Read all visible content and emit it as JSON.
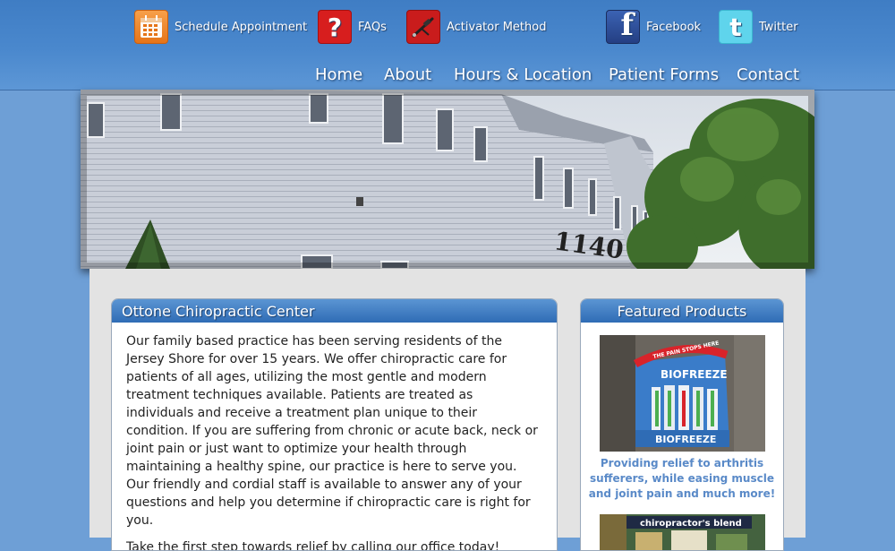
{
  "header": {
    "top_links": [
      {
        "label": "Schedule Appointment",
        "icon": "calendar-icon"
      },
      {
        "label": "FAQs",
        "icon": "question-mark-icon"
      },
      {
        "label": "Activator Method",
        "icon": "activator-tool-icon"
      },
      {
        "label": "Facebook",
        "icon": "facebook-icon"
      },
      {
        "label": "Twitter",
        "icon": "twitter-icon"
      }
    ],
    "nav": [
      "Home",
      "About",
      "Hours & Location",
      "Patient Forms",
      "Contact"
    ]
  },
  "banner": {
    "building_number": "1140"
  },
  "main_panel": {
    "title": "Ottone Chiropractic Center",
    "paragraphs": [
      "Our family based practice has been serving residents of the Jersey Shore for over 15 years. We offer chiropractic care for patients of all ages, utilizing the most gentle and modern treatment techniques available. Patients are treated as individuals and receive a treatment plan unique to their condition. If you are suffering from chronic or acute back, neck or joint pain or just want to optimize your health through maintaining a healthy spine, our practice is here to serve you. Our friendly and cordial staff is available to answer any of your questions and help you determine if chiropractic care is right for you.",
      "Take the first step towards relief by calling our office today!"
    ]
  },
  "products_panel": {
    "title": "Featured Products",
    "product1": {
      "caption": "Providing relief to arthritis sufferers, while easing muscle and joint pain and much more!",
      "display_top_text": "THE PAIN STOPS HERE",
      "display_brand": "BIOFREEZE"
    },
    "product2": {
      "brand": "chiropractor's blend"
    }
  },
  "colors": {
    "page_background": "#6e9fd6",
    "header_blue": "#4a88cd",
    "panel_header_blue": "#2f6cb5",
    "caption_blue": "#5a8ac8"
  }
}
